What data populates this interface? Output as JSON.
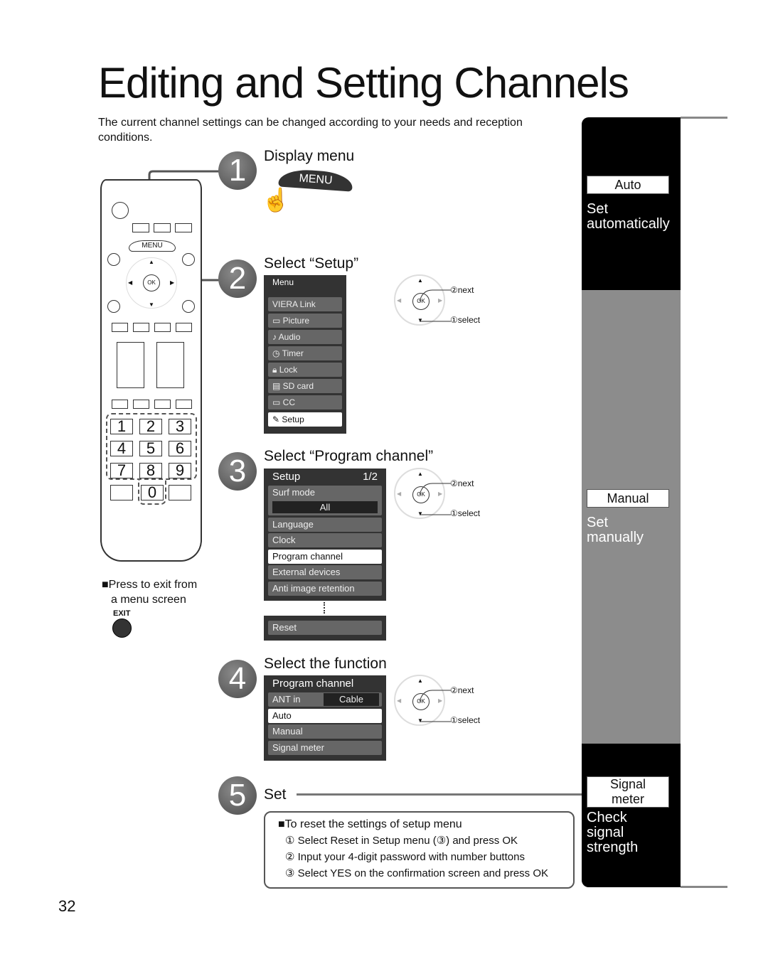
{
  "title": "Editing and Setting Channels",
  "intro": "The current channel settings can be changed according to your needs and reception conditions.",
  "steps": [
    {
      "num": "1",
      "title": "Display menu",
      "button": "MENU"
    },
    {
      "num": "2",
      "title": "Select “Setup”"
    },
    {
      "num": "3",
      "title": "Select “Program channel”"
    },
    {
      "num": "4",
      "title": "Select the function"
    },
    {
      "num": "5",
      "title": "Set"
    }
  ],
  "menu": {
    "header": "Menu",
    "items": [
      "VIERA Link",
      "Picture",
      "Audio",
      "Timer",
      "Lock",
      "SD card",
      "CC",
      "Setup"
    ],
    "selected": "Setup"
  },
  "setup_menu": {
    "header": "Setup",
    "page": "1/2",
    "surf_mode": "Surf mode",
    "surf_value": "All",
    "items": [
      "Language",
      "Clock",
      "Program channel",
      "External devices",
      "Anti image retention"
    ],
    "reset": "Reset",
    "selected": "Program channel"
  },
  "program_menu": {
    "header": "Program channel",
    "ant_label": "ANT in",
    "ant_value": "Cable",
    "items": [
      "Auto",
      "Manual",
      "Signal meter"
    ],
    "selected": "Auto"
  },
  "pad": {
    "ok": "OK",
    "next": "②next",
    "select": "①select"
  },
  "remote": {
    "menu": "MENU",
    "ok": "OK",
    "numbers": [
      "1",
      "2",
      "3",
      "4",
      "5",
      "6",
      "7",
      "8",
      "9",
      "0"
    ],
    "exit": "EXIT",
    "exit_note_1": "Press to exit from",
    "exit_note_2": "a menu screen"
  },
  "sidebar": {
    "auto_label": "Auto",
    "auto_desc_1": "Set",
    "auto_desc_2": "automatically",
    "manual_label": "Manual",
    "manual_desc_1": "Set",
    "manual_desc_2": "manually",
    "signal_label_1": "Signal",
    "signal_label_2": "meter",
    "signal_desc_1": "Check",
    "signal_desc_2": "signal",
    "signal_desc_3": "strength"
  },
  "note": {
    "title": "To reset the settings of setup menu",
    "lines": [
      "① Select  Reset  in Setup menu (③) and press OK",
      "② Input your 4-digit password with number buttons",
      "③ Select  YES  on the confirmation screen and press OK"
    ]
  },
  "page_number": "32"
}
